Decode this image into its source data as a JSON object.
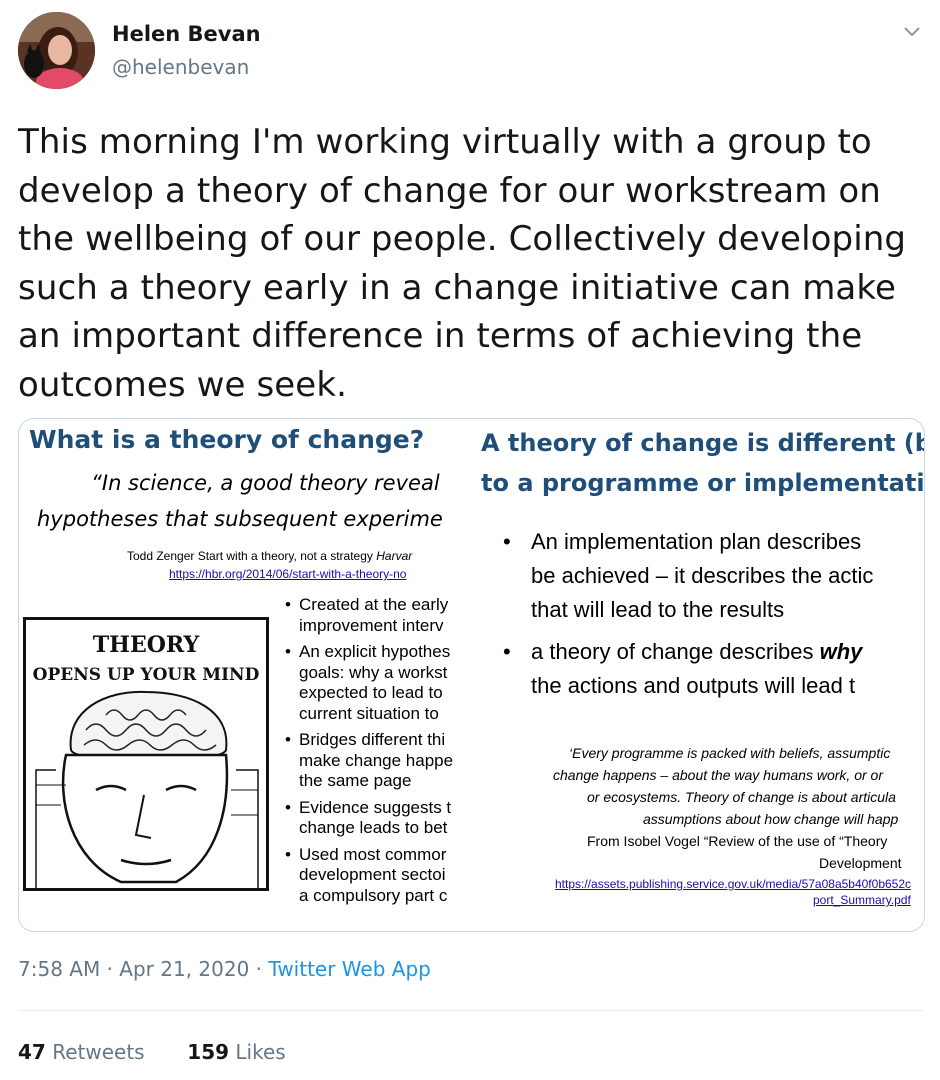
{
  "author": {
    "name": "Helen Bevan",
    "handle": "@helenbevan"
  },
  "tweet": {
    "text": "This morning I'm working virtually with a group to develop a theory of change for our workstream on the wellbeing of our people. Collectively developing such a theory early in a change initiative can make an important difference in terms of achieving the outcomes we seek."
  },
  "media": {
    "left_slide": {
      "title": "What is a theory of change?",
      "quote_line1": "“In science, a good theory reveal",
      "quote_line2": "hypotheses that subsequent experime",
      "citation": "Todd Zenger Start with a theory, not a strategy ",
      "citation_italic": "Harvar",
      "link": "https://hbr.org/2014/06/start-with-a-theory-no",
      "image_caption_line1": "THEORY",
      "image_caption_line2": "OPENS UP YOUR MIND",
      "bullets": [
        [
          "Created at the early",
          "improvement interv"
        ],
        [
          "An explicit hypothes",
          "goals:  why a workst",
          "expected to lead to",
          "current situation to"
        ],
        [
          "Bridges different thi",
          "make change happe",
          "the same page"
        ],
        [
          "Evidence suggests t",
          "change leads to bet"
        ],
        [
          "Used most commor",
          "development sectoi",
          "a compulsory part c"
        ]
      ]
    },
    "right_slide": {
      "title_line1": "A theory of change is different (b",
      "title_line2": "to a programme or implementati",
      "bullet1_lines": [
        "An implementation plan describes",
        "be achieved – it describes the actic",
        "that will lead to the results"
      ],
      "bullet2_prefix": "a theory of change describes ",
      "bullet2_emphasis": "why",
      "bullet2_line2": "the actions and outputs will lead t",
      "quote_lines": [
        "‘Every programme is packed with beliefs, assumptic",
        "change happens – about the way humans work, or or",
        "or ecosystems. Theory of change is about articula",
        "assumptions about how change will happ"
      ],
      "source_line1": "From Isobel Vogel “Review of the use of “Theory",
      "source_line2": "Development",
      "link_line1": "https://assets.publishing.service.gov.uk/media/57a08a5b40f0b652c",
      "link_line2": "port_Summary.pdf"
    }
  },
  "meta": {
    "time": "7:58 AM",
    "separator": " · ",
    "date": "Apr 21, 2020",
    "app": "Twitter Web App"
  },
  "stats": {
    "retweets_count": "47",
    "retweets_label": "Retweets",
    "likes_count": "159",
    "likes_label": "Likes"
  },
  "colors": {
    "text": "#14171a",
    "secondary": "#657786",
    "link": "#1b95e0",
    "slide_title": "#1f4e79"
  }
}
